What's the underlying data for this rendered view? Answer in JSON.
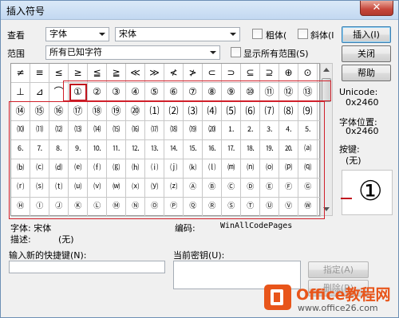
{
  "window": {
    "title": "插入符号",
    "close_glyph": "✕"
  },
  "toolbar": {
    "view_label": "查看",
    "view_value": "字体",
    "font_value": "宋体",
    "bold_label": "粗体(",
    "italic_label": "斜体(I",
    "insert_label": "插入(I)",
    "close_label": "关闭",
    "help_label": "帮助"
  },
  "range": {
    "label": "范围",
    "value": "所有已知字符",
    "show_all_label": "显示所有范围(S)"
  },
  "grid": {
    "rows": [
      [
        "≠",
        "≡",
        "≤",
        "≥",
        "≦",
        "≧",
        "≪",
        "≫",
        "≮",
        "≯",
        "⊂",
        "⊃",
        "⊆",
        "⊇",
        "⊕",
        "⊙"
      ],
      [
        "⊥",
        "⊿",
        "⌒",
        "①",
        "②",
        "③",
        "④",
        "⑤",
        "⑥",
        "⑦",
        "⑧",
        "⑨",
        "⑩",
        "⑪",
        "⑫",
        "⑬"
      ],
      [
        "⑭",
        "⑮",
        "⑯",
        "⑰",
        "⑱",
        "⑲",
        "⑳",
        "⑴",
        "⑵",
        "⑶",
        "⑷",
        "⑸",
        "⑹",
        "⑺",
        "⑻",
        "⑼"
      ],
      [
        "⑽",
        "⑾",
        "⑿",
        "⒀",
        "⒁",
        "⒂",
        "⒃",
        "⒄",
        "⒅",
        "⒆",
        "⒇",
        "⒈",
        "⒉",
        "⒊",
        "⒋",
        "⒌"
      ],
      [
        "⒍",
        "⒎",
        "⒏",
        "⒐",
        "⒑",
        "⒒",
        "⒓",
        "⒔",
        "⒕",
        "⒖",
        "⒗",
        "⒘",
        "⒙",
        "⒚",
        "⒛",
        "⒜"
      ],
      [
        "⒝",
        "⒞",
        "⒟",
        "⒠",
        "⒡",
        "⒢",
        "⒣",
        "⒤",
        "⒥",
        "⒦",
        "⒧",
        "⒨",
        "⒩",
        "⒪",
        "⒫",
        "⒬"
      ],
      [
        "⒭",
        "⒮",
        "⒯",
        "⒰",
        "⒱",
        "⒲",
        "⒳",
        "⒴",
        "⒵",
        "Ⓐ",
        "Ⓑ",
        "Ⓒ",
        "Ⓓ",
        "Ⓔ",
        "Ⓕ",
        "Ⓖ"
      ],
      [
        "Ⓗ",
        "Ⓘ",
        "Ⓙ",
        "Ⓚ",
        "Ⓛ",
        "Ⓜ",
        "Ⓝ",
        "Ⓞ",
        "Ⓟ",
        "Ⓠ",
        "Ⓡ",
        "Ⓢ",
        "Ⓣ",
        "Ⓤ",
        "Ⓥ",
        "Ⓦ"
      ]
    ]
  },
  "info": {
    "unicode_label": "Unicode:",
    "unicode_value": "0x2460",
    "font_pos_label": "字体位置:",
    "font_pos_value": "0x2460",
    "key_label": "按键:",
    "key_value": "(无)",
    "preview_char": "①"
  },
  "details": {
    "font_label": "字体: 宋体",
    "encoding_label": "编码:",
    "encoding_value": "WinAllCodePages",
    "desc_label": "描述:",
    "desc_value": "(无)"
  },
  "shortcut": {
    "new_key_label": "输入新的快捷键(N):",
    "current_key_label": "当前密钥(U):",
    "assign_label": "指定(A)",
    "remove_label": "删除(R)"
  },
  "watermark": {
    "brand": "Office教程网",
    "url": "www.office26.com"
  },
  "colors": {
    "accent_red": "#c0141e",
    "brand_orange": "#e8551a"
  }
}
